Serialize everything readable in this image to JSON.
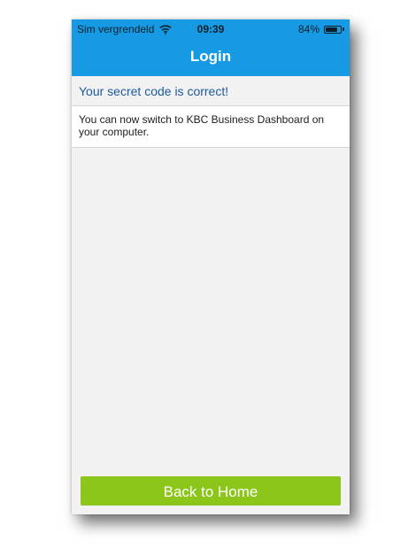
{
  "status_bar": {
    "carrier": "Sim vergrendeld",
    "time": "09:39",
    "battery": "84%",
    "battery_level": 0.84,
    "wifi_icon": "wifi-icon",
    "battery_icon": "battery-icon"
  },
  "header": {
    "title": "Login"
  },
  "content": {
    "success_message": "Your secret code is correct!",
    "info_message": "You can now switch to KBC Business Dashboard on your computer."
  },
  "footer": {
    "home_button_label": "Back to Home"
  },
  "colors": {
    "header": "#159ae3",
    "success_text": "#1e5aa0",
    "button": "#8cc61a",
    "background": "#f2f2f2"
  }
}
